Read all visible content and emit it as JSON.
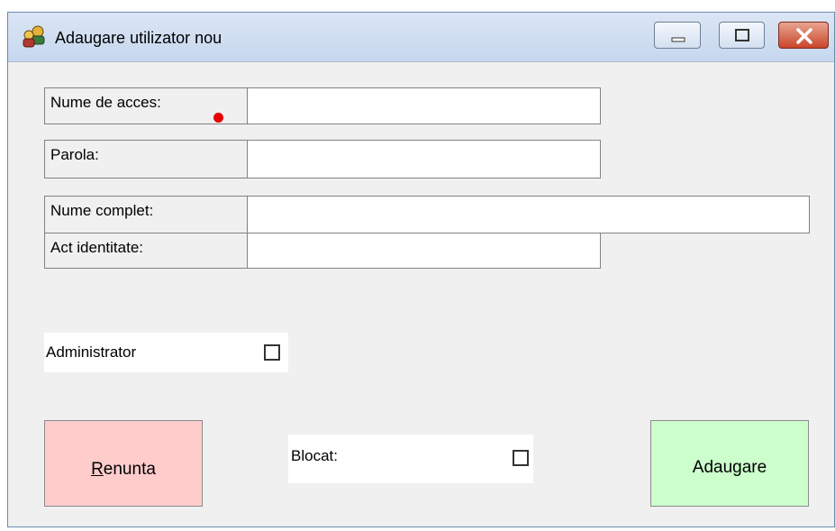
{
  "window": {
    "title": "Adaugare utilizator nou"
  },
  "form": {
    "username_label": "Nume de acces:",
    "username_value": "",
    "username_required": true,
    "password_label": "Parola:",
    "password_value": "",
    "fullname_label": "Nume complet:",
    "fullname_value": "",
    "id_doc_label": "Act identitate:",
    "id_doc_value": "",
    "admin_label": "Administrator",
    "admin_checked": false,
    "blocked_label": "Blocat:",
    "blocked_checked": false
  },
  "buttons": {
    "cancel_mnemonic": "R",
    "cancel_rest": "enunta",
    "add_label": "Adaugare"
  },
  "colors": {
    "required_marker": "#e60000",
    "cancel_bg": "#ffcccc",
    "add_bg": "#ccffcc"
  }
}
